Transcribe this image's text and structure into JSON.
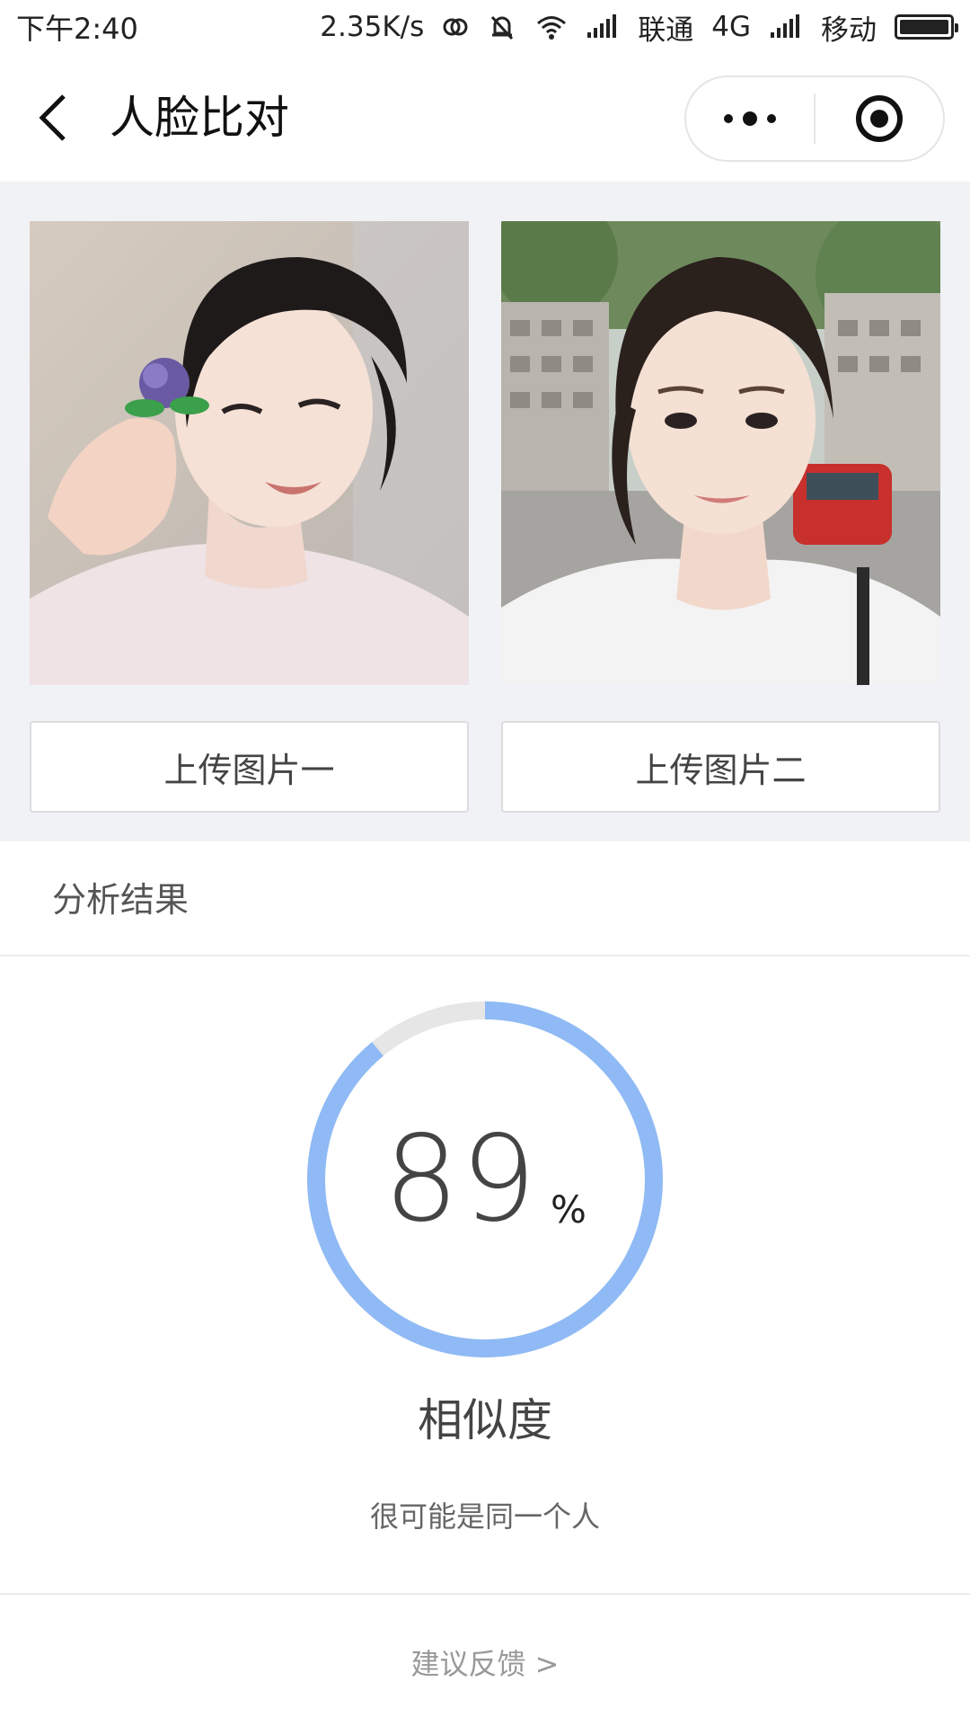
{
  "status_bar": {
    "time": "下午2:40",
    "net_speed": "2.35K/s",
    "carrier_1": "联通",
    "network_type": "4G",
    "carrier_2": "移动"
  },
  "nav": {
    "title": "人脸比对"
  },
  "photos": {
    "upload_1_label": "上传图片一",
    "upload_2_label": "上传图片二"
  },
  "result": {
    "header": "分析结果",
    "similarity_value": "89",
    "similarity_fraction": 0.89,
    "unit": "%",
    "label": "相似度",
    "conclusion": "很可能是同一个人",
    "feedback": "建议反馈 >"
  },
  "colors": {
    "gauge_progress": "#8fbaf5",
    "gauge_track": "#e6e6e6",
    "panel_bg": "#f1f2f6"
  }
}
